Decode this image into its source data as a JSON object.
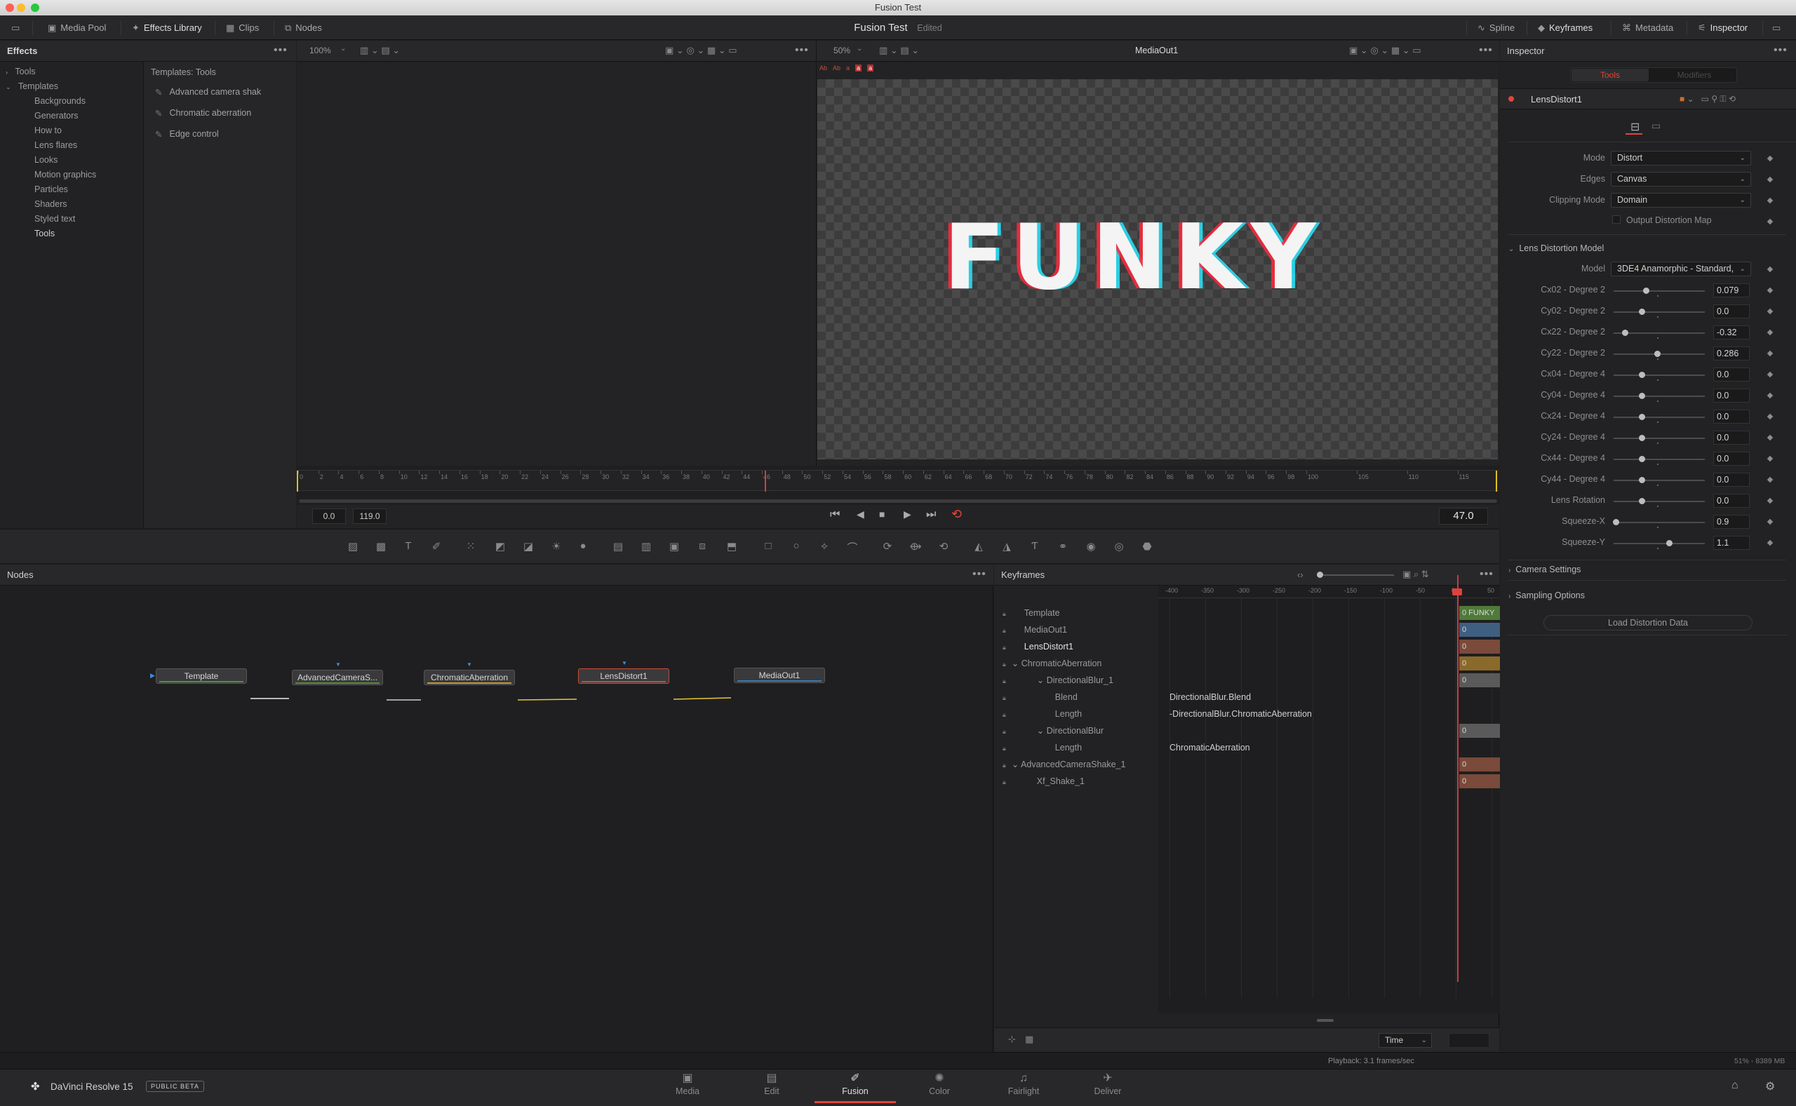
{
  "window": {
    "title": "Fusion Test"
  },
  "toolbar": {
    "media_pool": "Media Pool",
    "effects_library": "Effects Library",
    "clips": "Clips",
    "nodes": "Nodes",
    "project_title": "Fusion Test",
    "project_status": "Edited",
    "spline": "Spline",
    "keyframes": "Keyframes",
    "metadata": "Metadata",
    "inspector": "Inspector"
  },
  "effects": {
    "title": "Effects",
    "tree": [
      "Tools",
      "Templates",
      "Backgrounds",
      "Generators",
      "How to",
      "Lens flares",
      "Looks",
      "Motion graphics",
      "Particles",
      "Shaders",
      "Styled text",
      "Tools"
    ],
    "templates_header": "Templates: Tools",
    "templates": [
      "Advanced camera shak",
      "Chromatic aberration",
      "Edge control"
    ]
  },
  "viewer_left": {
    "zoom": "100%"
  },
  "viewer_right": {
    "zoom": "50%",
    "title": "MediaOut1",
    "overlay_text": "FUNKY",
    "overlay_labels": [
      "Ab",
      "Ab",
      "a",
      "a",
      "a"
    ]
  },
  "timeline": {
    "ticks": [
      "0",
      "2",
      "4",
      "6",
      "8",
      "10",
      "12",
      "14",
      "16",
      "18",
      "20",
      "22",
      "24",
      "26",
      "28",
      "30",
      "32",
      "34",
      "36",
      "38",
      "40",
      "42",
      "44",
      "46",
      "48",
      "50",
      "52",
      "54",
      "56",
      "58",
      "60",
      "62",
      "64",
      "66",
      "68",
      "70",
      "72",
      "74",
      "76",
      "78",
      "80",
      "82",
      "84",
      "86",
      "88",
      "90",
      "92",
      "94",
      "96",
      "98",
      "100",
      "105",
      "110",
      "115"
    ],
    "start": "0.0",
    "end": "119.0",
    "current_frame": "47.0"
  },
  "nodes": {
    "title": "Nodes",
    "items": [
      "Template",
      "AdvancedCameraS...",
      "ChromaticAberration",
      "LensDistort1",
      "MediaOut1"
    ]
  },
  "keyframes": {
    "title": "Keyframes",
    "ruler": [
      "-400",
      "-350",
      "-300",
      "-250",
      "-200",
      "-150",
      "-100",
      "-50",
      "0",
      "50"
    ],
    "rows": [
      {
        "name": "Template",
        "indent": 0
      },
      {
        "name": "MediaOut1",
        "indent": 0
      },
      {
        "name": "LensDistort1",
        "indent": 0
      },
      {
        "name": "ChromaticAberration",
        "indent": 0
      },
      {
        "name": "DirectionalBlur_1",
        "indent": 1
      },
      {
        "name": "Blend",
        "indent": 2
      },
      {
        "name": "Length",
        "indent": 2
      },
      {
        "name": "DirectionalBlur",
        "indent": 1
      },
      {
        "name": "Length",
        "indent": 2
      },
      {
        "name": "AdvancedCameraShake_1",
        "indent": 0
      },
      {
        "name": "Xf_Shake_1",
        "indent": 1
      }
    ],
    "expressions": [
      "DirectionalBlur.Blend",
      "-DirectionalBlur.ChromaticAberration",
      "ChromaticAberration"
    ],
    "block_label": "FUNKY",
    "block_zero": "0",
    "block_colors": [
      "#4f7a3a",
      "#3f5f80",
      "#7a4a3a",
      "#8a6a2a",
      "#5a5a5a",
      "#5a5a5a",
      "#7a4a3a",
      "#7a4a3a"
    ],
    "time_mode": "Time"
  },
  "inspector": {
    "title": "Inspector",
    "tab_tools": "Tools",
    "tab_modifiers": "Modifiers",
    "node_name": "LensDistort1",
    "mode_label": "Mode",
    "mode_value": "Distort",
    "edges_label": "Edges",
    "edges_value": "Canvas",
    "clipping_label": "Clipping Mode",
    "clipping_value": "Domain",
    "output_distortion": "Output Distortion Map",
    "lens_model_section": "Lens Distortion Model",
    "model_label": "Model",
    "model_value": "3DE4 Anamorphic - Standard, ",
    "params": [
      {
        "label": "Cx02 - Degree 2",
        "value": "0.079",
        "pos": 0.35
      },
      {
        "label": "Cy02 - Degree 2",
        "value": "0.0",
        "pos": 0.31
      },
      {
        "label": "Cx22 - Degree 2",
        "value": "-0.32",
        "pos": 0.12
      },
      {
        "label": "Cy22 - Degree 2",
        "value": "0.286",
        "pos": 0.48
      },
      {
        "label": "Cx04 - Degree 4",
        "value": "0.0",
        "pos": 0.31
      },
      {
        "label": "Cy04 - Degree 4",
        "value": "0.0",
        "pos": 0.31
      },
      {
        "label": "Cx24 - Degree 4",
        "value": "0.0",
        "pos": 0.31
      },
      {
        "label": "Cy24 - Degree 4",
        "value": "0.0",
        "pos": 0.31
      },
      {
        "label": "Cx44 - Degree 4",
        "value": "0.0",
        "pos": 0.31
      },
      {
        "label": "Cy44 - Degree 4",
        "value": "0.0",
        "pos": 0.31
      },
      {
        "label": "Lens Rotation",
        "value": "0.0",
        "pos": 0.31
      },
      {
        "label": "Squeeze-X",
        "value": "0.9",
        "pos": 0.02
      },
      {
        "label": "Squeeze-Y",
        "value": "1.1",
        "pos": 0.61
      }
    ],
    "camera_settings": "Camera Settings",
    "sampling_options": "Sampling Options",
    "load_button": "Load Distortion Data"
  },
  "status": {
    "playback": "Playback: 3.1 frames/sec",
    "memory": "51% - 8389 MB"
  },
  "bottom": {
    "app_name": "DaVinci Resolve 15",
    "beta_badge": "PUBLIC BETA",
    "pages": [
      "Media",
      "Edit",
      "Fusion",
      "Color",
      "Fairlight",
      "Deliver"
    ],
    "active_page": "Fusion",
    "accent": "#e0463a"
  }
}
